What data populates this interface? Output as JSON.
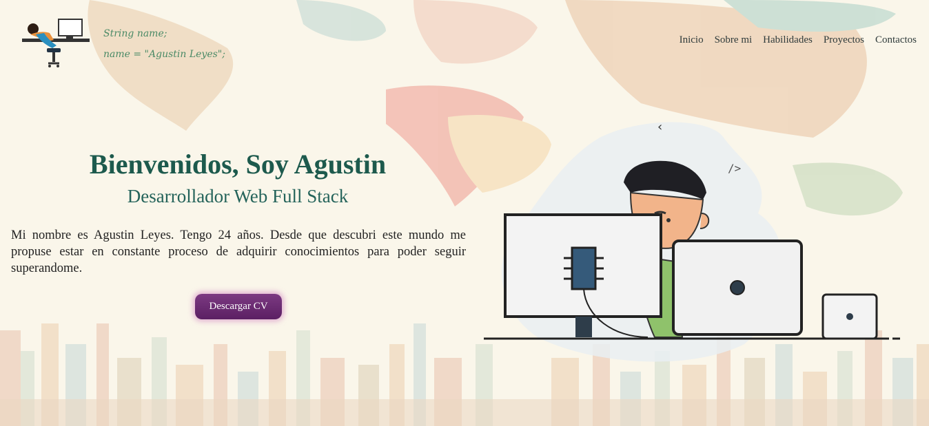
{
  "header": {
    "code_line_1": "String name;",
    "code_line_2": "name = \"Agustin Leyes\";",
    "logo_icon": "developer-at-desk-icon"
  },
  "nav": {
    "items": [
      "Inicio",
      "Sobre mi",
      "Habilidades",
      "Proyectos",
      "Contactos"
    ]
  },
  "hero": {
    "title": "Bienvenidos, Soy Agustin",
    "subtitle": "Desarrollador Web Full Stack",
    "paragraph": "Mi nombre es Agustin Leyes. Tengo 24 años. Desde que descubri este mundo me propuse estar en constante proceso de adquirir conocimientos para poder seguir superandome.",
    "cv_button": "Descargar CV"
  },
  "illustration": {
    "chevron_text": "‹",
    "code_tag_text": "/>",
    "icon": "developer-with-computers-icon"
  },
  "colors": {
    "background": "#faf6ea",
    "title": "#1d5a4d",
    "button": "#6b2a72",
    "code_text": "#4a8a66"
  }
}
